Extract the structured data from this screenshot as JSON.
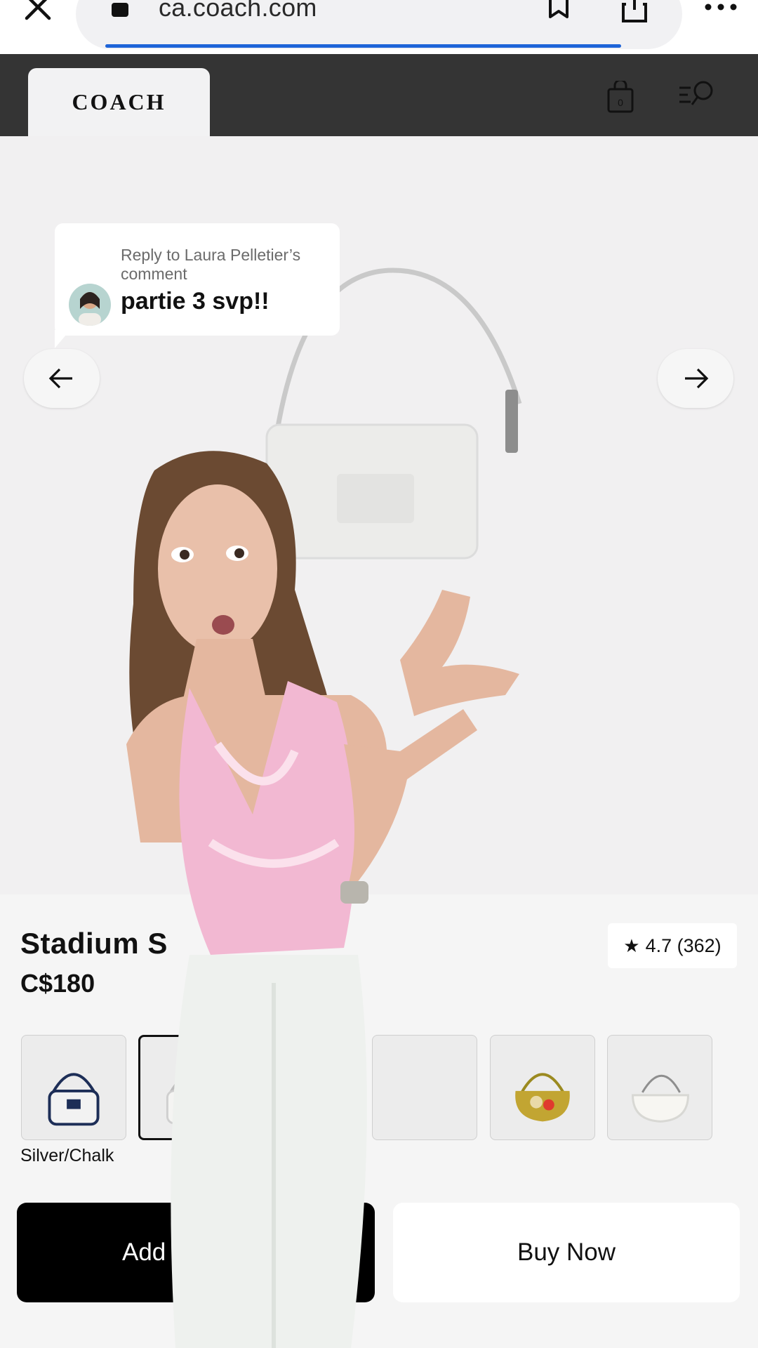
{
  "browser": {
    "url": "ca.coach.com",
    "icons": [
      "close-icon",
      "lock-icon",
      "bookmark-icon",
      "share-icon",
      "more-icon"
    ]
  },
  "header": {
    "logo": "COACH",
    "bag_count": "0",
    "icons": [
      "shopping-bag-icon",
      "menu-search-icon"
    ]
  },
  "comment": {
    "meta": "Reply to Laura Pelletier’s comment",
    "text": "partie 3 svp!!"
  },
  "product": {
    "name": "Stadium S",
    "price": "C$180",
    "rating": "4.7 (362)",
    "selected_color": "Silver/Chalk"
  },
  "swatches": [
    {
      "name": "navy-bag"
    },
    {
      "name": "chalk-bag",
      "selected": true
    },
    {
      "name": "hidden-bag"
    },
    {
      "name": "hidden-bag-2"
    },
    {
      "name": "yellow-bag"
    },
    {
      "name": "white-bag"
    }
  ],
  "actions": {
    "add": "Add",
    "buy": "Buy Now"
  },
  "colors": {
    "header_bg": "#343434",
    "stage_bg": "#f1f0f1",
    "progress": "#1e64d8",
    "top_pink": "#f2b8d2"
  }
}
